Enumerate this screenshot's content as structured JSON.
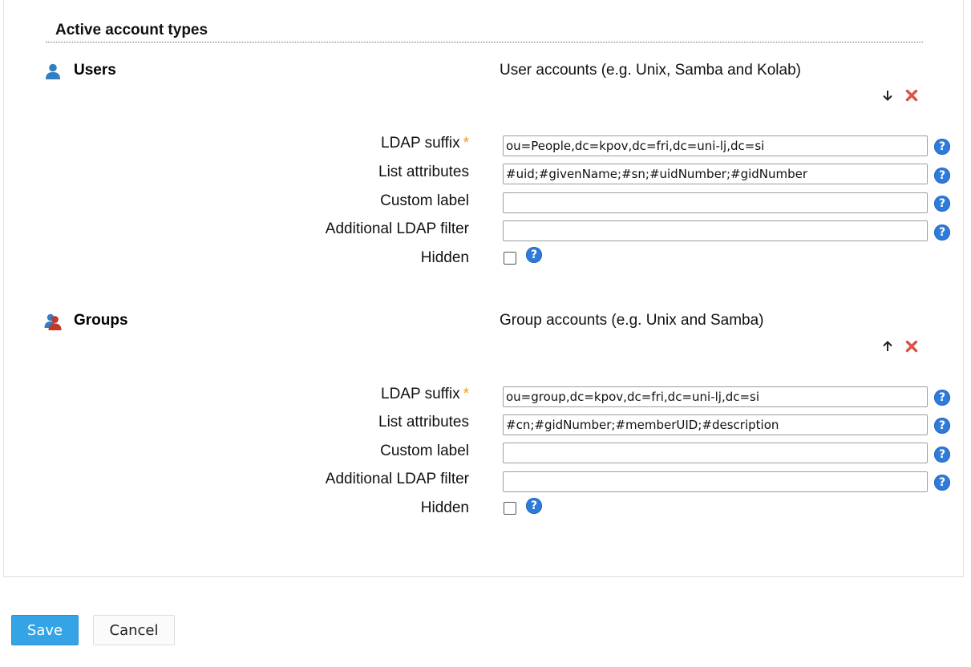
{
  "section": {
    "title": "Active account types"
  },
  "account_types": [
    {
      "name": "Users",
      "icon": "user-icon",
      "description": "User accounts (e.g. Unix, Samba and Kolab)",
      "move_icon": "arrow-down-icon",
      "delete_icon": "delete-icon",
      "fields": {
        "ldap_suffix": {
          "label": "LDAP suffix",
          "required_mark": "*",
          "value": "ou=People,dc=kpov,dc=fri,dc=uni-lj,dc=si"
        },
        "list_attributes": {
          "label": "List attributes",
          "value": "#uid;#givenName;#sn;#uidNumber;#gidNumber"
        },
        "custom_label": {
          "label": "Custom label",
          "value": ""
        },
        "additional_filter": {
          "label": "Additional LDAP filter",
          "value": ""
        },
        "hidden": {
          "label": "Hidden",
          "checked": false
        }
      }
    },
    {
      "name": "Groups",
      "icon": "group-icon",
      "description": "Group accounts (e.g. Unix and Samba)",
      "move_icon": "arrow-up-icon",
      "delete_icon": "delete-icon",
      "fields": {
        "ldap_suffix": {
          "label": "LDAP suffix",
          "required_mark": "*",
          "value": "ou=group,dc=kpov,dc=fri,dc=uni-lj,dc=si"
        },
        "list_attributes": {
          "label": "List attributes",
          "value": "#cn;#gidNumber;#memberUID;#description"
        },
        "custom_label": {
          "label": "Custom label",
          "value": ""
        },
        "additional_filter": {
          "label": "Additional LDAP filter",
          "value": ""
        },
        "hidden": {
          "label": "Hidden",
          "checked": false
        }
      }
    }
  ],
  "help_glyph": "?",
  "buttons": {
    "save": "Save",
    "cancel": "Cancel"
  },
  "colors": {
    "accent": "#35a4e6",
    "help": "#2e7bd9",
    "required": "#f39c12",
    "delete": "#d9534f",
    "user_icon": "#2f7fc1",
    "group_icon": "#c0392b"
  }
}
